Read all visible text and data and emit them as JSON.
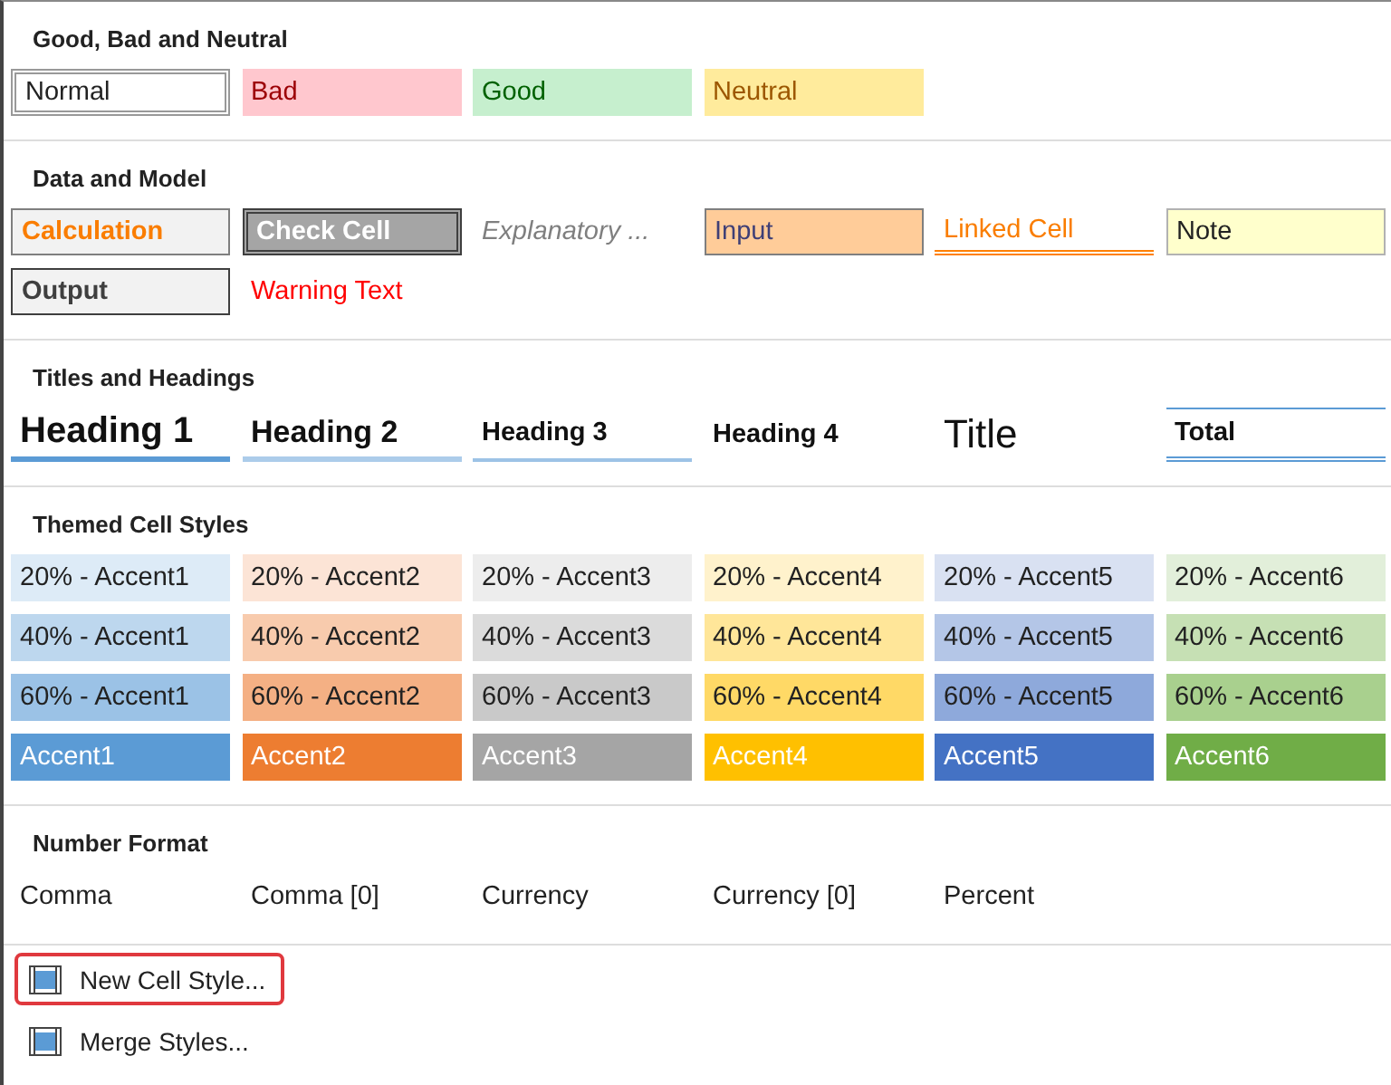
{
  "sections": [
    {
      "title": "Good, Bad and Neutral",
      "rows": [
        [
          {
            "label": "Normal",
            "kind": "normal"
          },
          {
            "label": "Bad",
            "kind": "bad"
          },
          {
            "label": "Good",
            "kind": "good"
          },
          {
            "label": "Neutral",
            "kind": "neutral"
          }
        ]
      ]
    },
    {
      "title": "Data and Model",
      "rows": [
        [
          {
            "label": "Calculation",
            "kind": "calculation"
          },
          {
            "label": "Check Cell",
            "kind": "check"
          },
          {
            "label": "Explanatory ...",
            "kind": "explanatory"
          },
          {
            "label": "Input",
            "kind": "input"
          },
          {
            "label": "Linked Cell",
            "kind": "linked"
          },
          {
            "label": "Note",
            "kind": "note"
          }
        ],
        [
          {
            "label": "Output",
            "kind": "output"
          },
          {
            "label": "Warning Text",
            "kind": "warning"
          }
        ]
      ]
    },
    {
      "title": "Titles and Headings",
      "rows": [
        [
          {
            "label": "Heading 1",
            "kind": "h1"
          },
          {
            "label": "Heading 2",
            "kind": "h2"
          },
          {
            "label": "Heading 3",
            "kind": "h3"
          },
          {
            "label": "Heading 4",
            "kind": "h4"
          },
          {
            "label": "Title",
            "kind": "title"
          },
          {
            "label": "Total",
            "kind": "total"
          }
        ]
      ]
    },
    {
      "title": "Themed Cell Styles",
      "rows": [
        [
          {
            "label": "20% - Accent1",
            "kind": "tint",
            "color": "#ddebf7"
          },
          {
            "label": "20% - Accent2",
            "kind": "tint",
            "color": "#fce4d6"
          },
          {
            "label": "20% - Accent3",
            "kind": "tint",
            "color": "#ededed"
          },
          {
            "label": "20% - Accent4",
            "kind": "tint",
            "color": "#fff2cc"
          },
          {
            "label": "20% - Accent5",
            "kind": "tint",
            "color": "#d9e1f2"
          },
          {
            "label": "20% - Accent6",
            "kind": "tint",
            "color": "#e2efda"
          }
        ],
        [
          {
            "label": "40% - Accent1",
            "kind": "tint",
            "color": "#bdd7ee"
          },
          {
            "label": "40% - Accent2",
            "kind": "tint",
            "color": "#f8cbad"
          },
          {
            "label": "40% - Accent3",
            "kind": "tint",
            "color": "#dbdbdb"
          },
          {
            "label": "40% - Accent4",
            "kind": "tint",
            "color": "#ffe699"
          },
          {
            "label": "40% - Accent5",
            "kind": "tint",
            "color": "#b4c6e7"
          },
          {
            "label": "40% - Accent6",
            "kind": "tint",
            "color": "#c6e0b4"
          }
        ],
        [
          {
            "label": "60% - Accent1",
            "kind": "tint",
            "color": "#9bc2e6"
          },
          {
            "label": "60% - Accent2",
            "kind": "tint",
            "color": "#f4b084"
          },
          {
            "label": "60% - Accent3",
            "kind": "tint",
            "color": "#c9c9c9"
          },
          {
            "label": "60% - Accent4",
            "kind": "tint",
            "color": "#ffd966"
          },
          {
            "label": "60% - Accent5",
            "kind": "tint",
            "color": "#8ea9db"
          },
          {
            "label": "60% - Accent6",
            "kind": "tint",
            "color": "#a9d08e"
          }
        ],
        [
          {
            "label": "Accent1",
            "kind": "solid",
            "color": "#5b9bd5"
          },
          {
            "label": "Accent2",
            "kind": "solid",
            "color": "#ed7d31"
          },
          {
            "label": "Accent3",
            "kind": "solid",
            "color": "#a5a5a5"
          },
          {
            "label": "Accent4",
            "kind": "solid",
            "color": "#ffc000"
          },
          {
            "label": "Accent5",
            "kind": "solid",
            "color": "#4472c4"
          },
          {
            "label": "Accent6",
            "kind": "solid",
            "color": "#70ad47"
          }
        ]
      ]
    },
    {
      "title": "Number Format",
      "rows": [
        [
          {
            "label": "Comma",
            "kind": "plain"
          },
          {
            "label": "Comma [0]",
            "kind": "plain"
          },
          {
            "label": "Currency",
            "kind": "plain"
          },
          {
            "label": "Currency [0]",
            "kind": "plain"
          },
          {
            "label": "Percent",
            "kind": "plain"
          }
        ]
      ]
    }
  ],
  "menu": [
    {
      "label": "New Cell Style...",
      "highlighted": true
    },
    {
      "label": "Merge Styles...",
      "highlighted": false
    }
  ]
}
